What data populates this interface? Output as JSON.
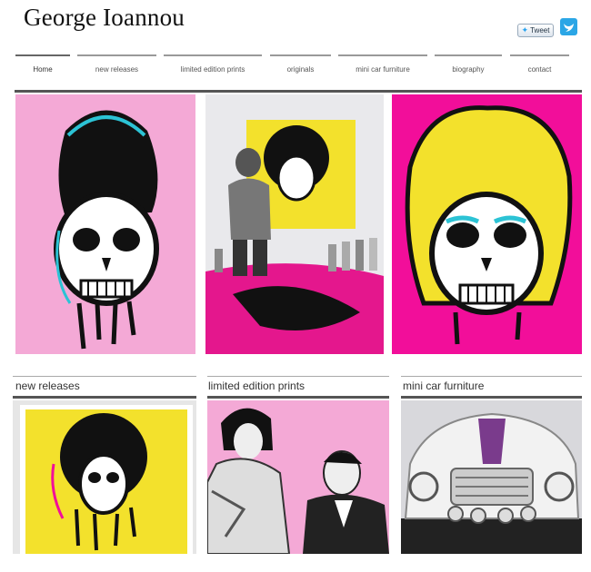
{
  "header": {
    "title": "George Ioannou",
    "tweet_label": "Tweet"
  },
  "icons": {
    "tweet": "twitter-bird-icon",
    "twitter": "twitter-icon"
  },
  "nav": {
    "items": [
      {
        "label": "Home",
        "active": true
      },
      {
        "label": "new releases"
      },
      {
        "label": "limited edition prints"
      },
      {
        "label": "originals"
      },
      {
        "label": "mini car furniture"
      },
      {
        "label": "biography"
      },
      {
        "label": "contact"
      }
    ]
  },
  "sections": [
    {
      "title": "new releases"
    },
    {
      "title": "limited edition prints"
    },
    {
      "title": "mini car furniture"
    }
  ],
  "colors": {
    "pink": "#f4a9d6",
    "magenta": "#f20e9a",
    "yellow": "#f3e12c",
    "cyan": "#2cc3d5",
    "twitter": "#2ba6e6"
  }
}
